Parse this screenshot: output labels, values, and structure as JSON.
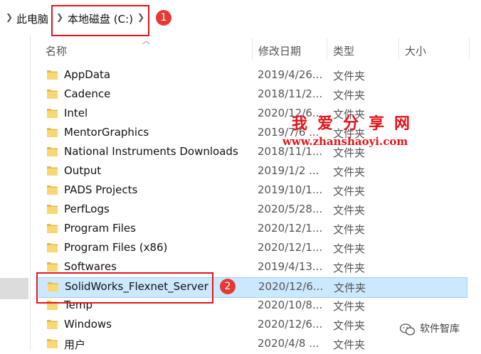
{
  "breadcrumb": {
    "items": [
      "此电脑",
      "本地磁盘 (C:)"
    ]
  },
  "columns": {
    "name": "名称",
    "date": "修改日期",
    "type": "类型",
    "size": "大小"
  },
  "files": [
    {
      "name": "AppData",
      "date": "2019/4/26...",
      "type": "文件夹"
    },
    {
      "name": "Cadence",
      "date": "2018/11/2...",
      "type": "文件夹"
    },
    {
      "name": "Intel",
      "date": "2020/12/6...",
      "type": "文件夹"
    },
    {
      "name": "MentorGraphics",
      "date": "2019/7/6 ...",
      "type": "文件夹"
    },
    {
      "name": "National Instruments Downloads",
      "date": "2018/11/1...",
      "type": "文件夹"
    },
    {
      "name": "Output",
      "date": "2019/1/2 ...",
      "type": "文件夹"
    },
    {
      "name": "PADS Projects",
      "date": "2019/10/1...",
      "type": "文件夹"
    },
    {
      "name": "PerfLogs",
      "date": "2020/5/28...",
      "type": "文件夹"
    },
    {
      "name": "Program Files",
      "date": "2020/12/1...",
      "type": "文件夹"
    },
    {
      "name": "Program Files (x86)",
      "date": "2020/12/1...",
      "type": "文件夹"
    },
    {
      "name": "Softwares",
      "date": "2019/4/13...",
      "type": "文件夹"
    },
    {
      "name": "SolidWorks_Flexnet_Server",
      "date": "2020/12/6...",
      "type": "文件夹"
    },
    {
      "name": "Temp",
      "date": "2020/10/8...",
      "type": "文件夹"
    },
    {
      "name": "Windows",
      "date": "2020/12/6...",
      "type": "文件夹"
    },
    {
      "name": "用户",
      "date": "2020/4/8 ...",
      "type": "文件夹"
    }
  ],
  "selected_index": 11,
  "annotations": {
    "badge1": "1",
    "badge2": "2"
  },
  "watermark": {
    "title": "我爱分享网",
    "url": "www.zhanshaoyi.com"
  },
  "wechat_label": "软件智库",
  "colors": {
    "selection_bg": "#cce8ff",
    "selection_border": "#99d1ff",
    "highlight_red": "#e3141a",
    "folder_yellow": "#f8d775"
  }
}
